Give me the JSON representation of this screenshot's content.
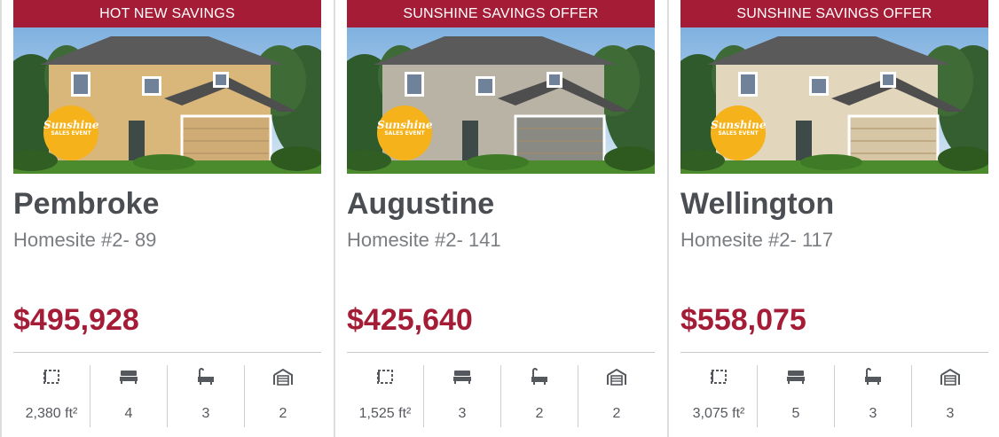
{
  "listings": [
    {
      "banner": "HOT NEW SAVINGS",
      "badge_line1": "Sunshine",
      "badge_line2": "SALES EVENT",
      "name": "Pembroke",
      "homesite": "Homesite #2- 89",
      "price": "$495,928",
      "specs": {
        "area": "2,380 ft²",
        "beds": "4",
        "baths": "3",
        "garage": "2"
      },
      "house_color": "#d9b67a",
      "garage_color": "#cfab76"
    },
    {
      "banner": "SUNSHINE SAVINGS OFFER",
      "badge_line1": "Sunshine",
      "badge_line2": "SALES EVENT",
      "name": "Augustine",
      "homesite": "Homesite #2- 141",
      "price": "$425,640",
      "specs": {
        "area": "1,525 ft²",
        "beds": "3",
        "baths": "2",
        "garage": "2"
      },
      "house_color": "#b9b3a6",
      "garage_color": "#8a8a84"
    },
    {
      "banner": "SUNSHINE SAVINGS OFFER",
      "badge_line1": "Sunshine",
      "badge_line2": "SALES EVENT",
      "name": "Wellington",
      "homesite": "Homesite #2- 117",
      "price": "$558,075",
      "specs": {
        "area": "3,075 ft²",
        "beds": "5",
        "baths": "3",
        "garage": "3"
      },
      "house_color": "#e2d6bd",
      "garage_color": "#d6c6a6"
    }
  ],
  "icons": {
    "area": "floor-plan-icon",
    "beds": "bed-icon",
    "baths": "bathtub-icon",
    "garage": "garage-icon"
  },
  "colors": {
    "accent": "#a51c36",
    "badge": "#f6b21a",
    "text": "#4a4d52"
  }
}
